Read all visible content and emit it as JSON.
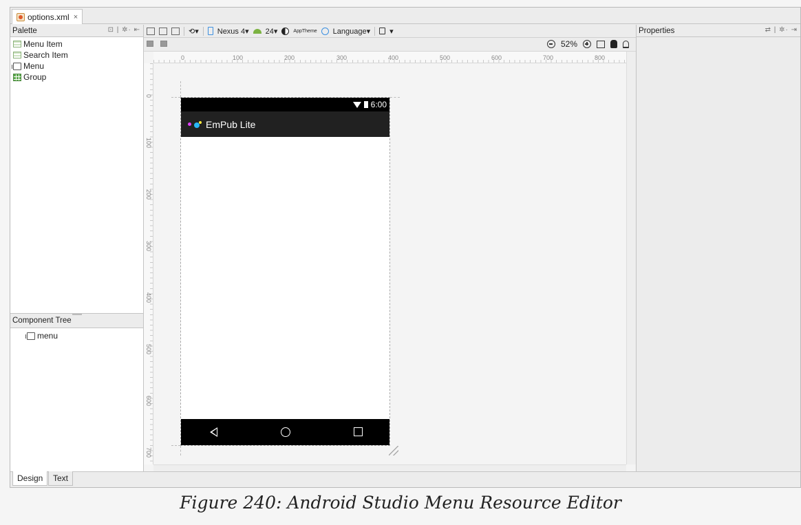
{
  "file_tab": {
    "label": "options.xml",
    "close": "×"
  },
  "palette": {
    "title": "Palette",
    "tools": "⊡ | ✲· ⇤",
    "items": [
      {
        "label": "Menu Item",
        "icon": "menu-item-icon"
      },
      {
        "label": "Search Item",
        "icon": "search-item-icon"
      },
      {
        "label": "Menu",
        "icon": "menu-icon"
      },
      {
        "label": "Group",
        "icon": "group-icon"
      }
    ]
  },
  "component_tree": {
    "title": "Component Tree",
    "items": [
      {
        "label": "menu"
      }
    ]
  },
  "toolbar": {
    "device": "Nexus 4",
    "api": "24",
    "theme": "AppTheme",
    "language": "Language",
    "dropdown_arrow": "▾"
  },
  "zoom": {
    "level": "52%"
  },
  "ruler": {
    "top": [
      "0",
      "100",
      "200",
      "300",
      "400",
      "500",
      "600",
      "700",
      "800"
    ],
    "left": [
      "0",
      "100",
      "200",
      "300",
      "400",
      "500",
      "600",
      "700"
    ]
  },
  "phone": {
    "time": "6:00",
    "app_title": "EmPub Lite"
  },
  "properties": {
    "title": "Properties",
    "tools": "⇄ | ✲· ⇥"
  },
  "bottom_tabs": {
    "design": "Design",
    "text": "Text"
  },
  "caption": "Figure 240: Android Studio Menu Resource Editor"
}
